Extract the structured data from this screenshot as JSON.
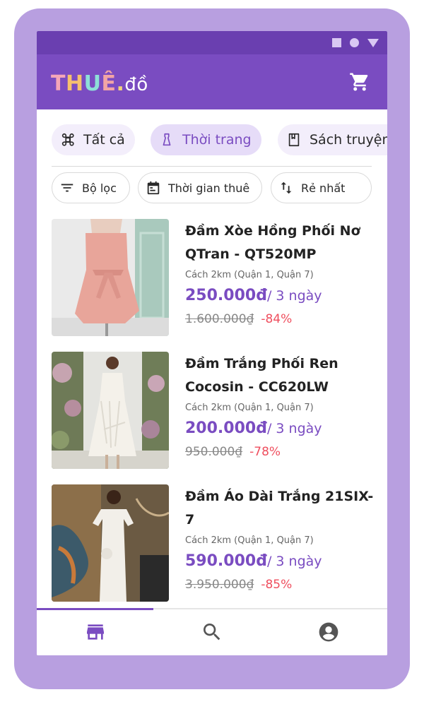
{
  "app": {
    "logo_parts": [
      "T",
      "H",
      "U",
      "Ê",
      ".",
      "đồ"
    ]
  },
  "categories": [
    {
      "label": "Tất cả",
      "icon": "grid-command-icon"
    },
    {
      "label": "Thời trang",
      "icon": "dress-icon",
      "selected": true
    },
    {
      "label": "Sách truyện",
      "icon": "book-icon"
    }
  ],
  "filters": [
    {
      "label": "Bộ lọc",
      "icon": "filter-icon"
    },
    {
      "label": "Thời gian thuê",
      "icon": "calendar-icon"
    },
    {
      "label": "Rẻ nhất",
      "icon": "sort-icon"
    }
  ],
  "products": [
    {
      "title": "Đầm Xòe Hồng Phối Nơ QTran - QT520MP",
      "distance": "Cách 2km (Quận 1, Quận 7)",
      "price": "250.000đ",
      "per": "/ 3 ngày",
      "old_price": "1.600.000₫",
      "discount": "-84%"
    },
    {
      "title": "Đầm Trắng Phối Ren Cocosin - CC620LW",
      "distance": "Cách 2km (Quận 1, Quận 7)",
      "price": "200.000đ",
      "per": "/ 3 ngày",
      "old_price": "950.000₫",
      "discount": "-78%"
    },
    {
      "title": "Đầm Áo Dài Trắng 21SIX-7",
      "distance": "Cách 2km (Quận 1, Quận 7)",
      "price": "590.000đ",
      "per": "/ 3 ngày",
      "old_price": "3.950.000₫",
      "discount": "-85%"
    }
  ],
  "bottom_nav": [
    {
      "icon": "store-icon",
      "active": true
    },
    {
      "icon": "search-icon",
      "active": false
    },
    {
      "icon": "account-icon",
      "active": false
    }
  ],
  "colors": {
    "accent": "#7a4cc1",
    "frame": "#b89fe0",
    "discount": "#ef4e5e"
  }
}
